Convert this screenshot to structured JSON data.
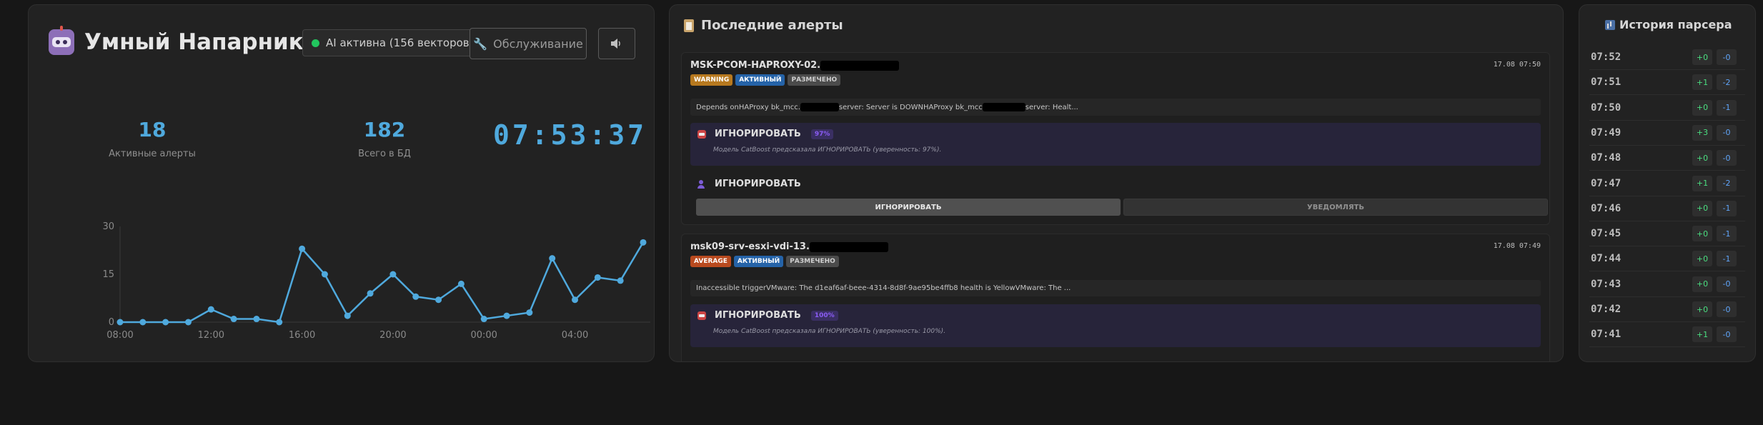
{
  "header": {
    "title": "Умный Напарник",
    "ai_status": "AI активна (156 векторов)",
    "maintenance_label": "Обслуживание"
  },
  "stats": {
    "active_alerts_value": "18",
    "active_alerts_label": "Активные алерты",
    "total_db_value": "182",
    "total_db_label": "Всего в БД",
    "clock": "07:53:37"
  },
  "chart_data": {
    "type": "line",
    "y": [
      0,
      0,
      0,
      0,
      4,
      1,
      1,
      0,
      23,
      15,
      2,
      9,
      15,
      8,
      7,
      12,
      1,
      2,
      3,
      20,
      7,
      14,
      13,
      25
    ],
    "ylim": [
      0,
      30
    ],
    "y_ticks": [
      "0",
      "15",
      "30"
    ],
    "x_ticks": [
      "08:00",
      "12:00",
      "16:00",
      "20:00",
      "00:00",
      "04:00"
    ],
    "color": "#4fa9dd"
  },
  "alerts_panel": {
    "title": "Последние алерты",
    "alerts": [
      {
        "host": "MSK-PCOM-HAPROXY-02.",
        "time": "17.08 07:50",
        "severity": "WARNING",
        "status": "АКТИВНЫЙ",
        "marked": "РАЗМЕЧЕНО",
        "desc_a": "Depends onHAProxy bk_mcc.",
        "desc_b": "server: Server is DOWNHAProxy bk_mcc",
        "desc_c": "server: Healt...",
        "prediction": "ИГНОРИРОВАТЬ",
        "confidence": "97%",
        "note": "Модель CatBoost предсказала ИГНОРИРОВАТЬ (уверенность: 97%).",
        "user_decision": "ИГНОРИРОВАТЬ",
        "choice_ignore": "ИГНОРИРОВАТЬ",
        "choice_notify": "УВЕДОМЛЯТЬ"
      },
      {
        "host": "msk09-srv-esxi-vdi-13.",
        "time": "17.08 07:49",
        "severity": "AVERAGE",
        "status": "АКТИВНЫЙ",
        "marked": "РАЗМЕЧЕНО",
        "desc": "Inaccessible triggerVMware: The d1eaf6af-beee-4314-8d8f-9ae95be4ffb8 health is YellowVMware: The ...",
        "prediction": "ИГНОРИРОВАТЬ",
        "confidence": "100%",
        "note": "Модель CatBoost предсказала ИГНОРИРОВАТЬ (уверенность: 100%)."
      }
    ]
  },
  "parser_history": {
    "title": "История парсера",
    "rows": [
      {
        "time": "07:52",
        "added": "+0",
        "removed": "-0"
      },
      {
        "time": "07:51",
        "added": "+1",
        "removed": "-2"
      },
      {
        "time": "07:50",
        "added": "+0",
        "removed": "-1"
      },
      {
        "time": "07:49",
        "added": "+3",
        "removed": "-0"
      },
      {
        "time": "07:48",
        "added": "+0",
        "removed": "-0"
      },
      {
        "time": "07:47",
        "added": "+1",
        "removed": "-2"
      },
      {
        "time": "07:46",
        "added": "+0",
        "removed": "-1"
      },
      {
        "time": "07:45",
        "added": "+0",
        "removed": "-1"
      },
      {
        "time": "07:44",
        "added": "+0",
        "removed": "-1"
      },
      {
        "time": "07:43",
        "added": "+0",
        "removed": "-0"
      },
      {
        "time": "07:42",
        "added": "+0",
        "removed": "-0"
      },
      {
        "time": "07:41",
        "added": "+1",
        "removed": "-0"
      }
    ]
  }
}
